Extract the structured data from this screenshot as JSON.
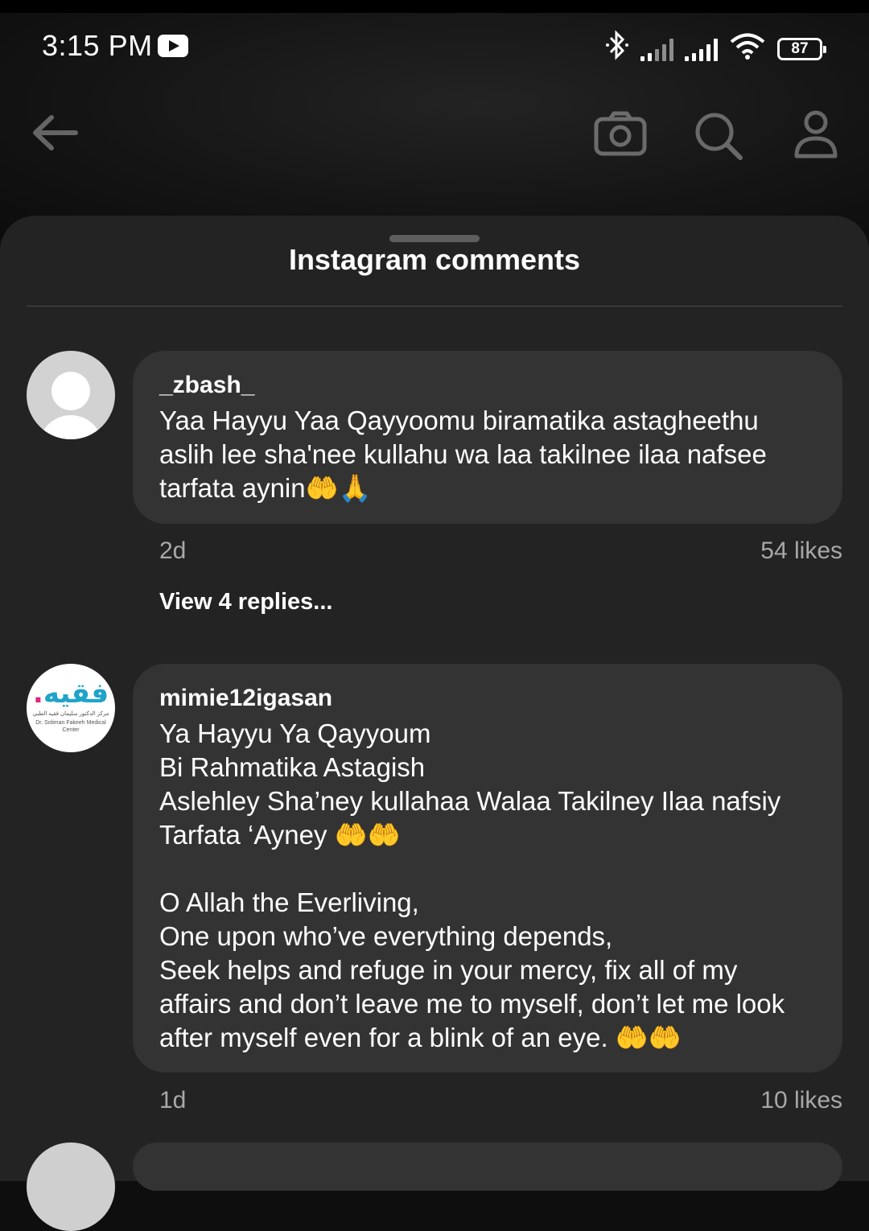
{
  "status_bar": {
    "time": "3:15 PM",
    "battery": "87",
    "icons": [
      "youtube-icon",
      "bluetooth-icon",
      "signal-icon",
      "signal-icon",
      "wifi-icon",
      "battery-icon"
    ]
  },
  "background_toolbar": {
    "icons": [
      "back-arrow-icon",
      "camera-icon",
      "search-icon",
      "profile-icon"
    ]
  },
  "sheet": {
    "title": "Instagram comments"
  },
  "comments": [
    {
      "username": "_zbash_",
      "text": "Yaa Hayyu Yaa Qayyoomu biramatika astagheethu aslih lee sha'nee kullahu wa laa takilnee ilaa nafsee tarfata aynin🤲🙏",
      "age": "2d",
      "likes": "54 likes",
      "replies_label": "View 4 replies...",
      "avatar": "default-avatar"
    },
    {
      "username": "mimie12igasan",
      "text": "Ya Hayyu Ya Qayyoum\nBi Rahmatika Astagish\nAslehley Sha’ney kullahaa Walaa Takilney Ilaa nafsiy Tarfata ‘Ayney 🤲🤲\n\nO Allah the Everliving,\nOne upon who’ve everything depends,\nSeek helps and refuge in your mercy, fix all of my affairs and don’t leave me to myself, don’t let me look after myself even for a blink of an eye. 🤲🤲",
      "age": "1d",
      "likes": "10 likes",
      "avatar_logo": {
        "arabic": "فقيه",
        "subtitle_ar": "مركز الدكتور سليمان فقيه الطبي",
        "subtitle_en": "Dr. Soliman Fakeeh Medical Center"
      }
    }
  ],
  "colors": {
    "sheet_bg": "#232324",
    "bubble_bg": "#333334",
    "meta_text": "#a8a8a8",
    "logo_teal": "#1fa3c9",
    "logo_pink": "#e0257a"
  }
}
